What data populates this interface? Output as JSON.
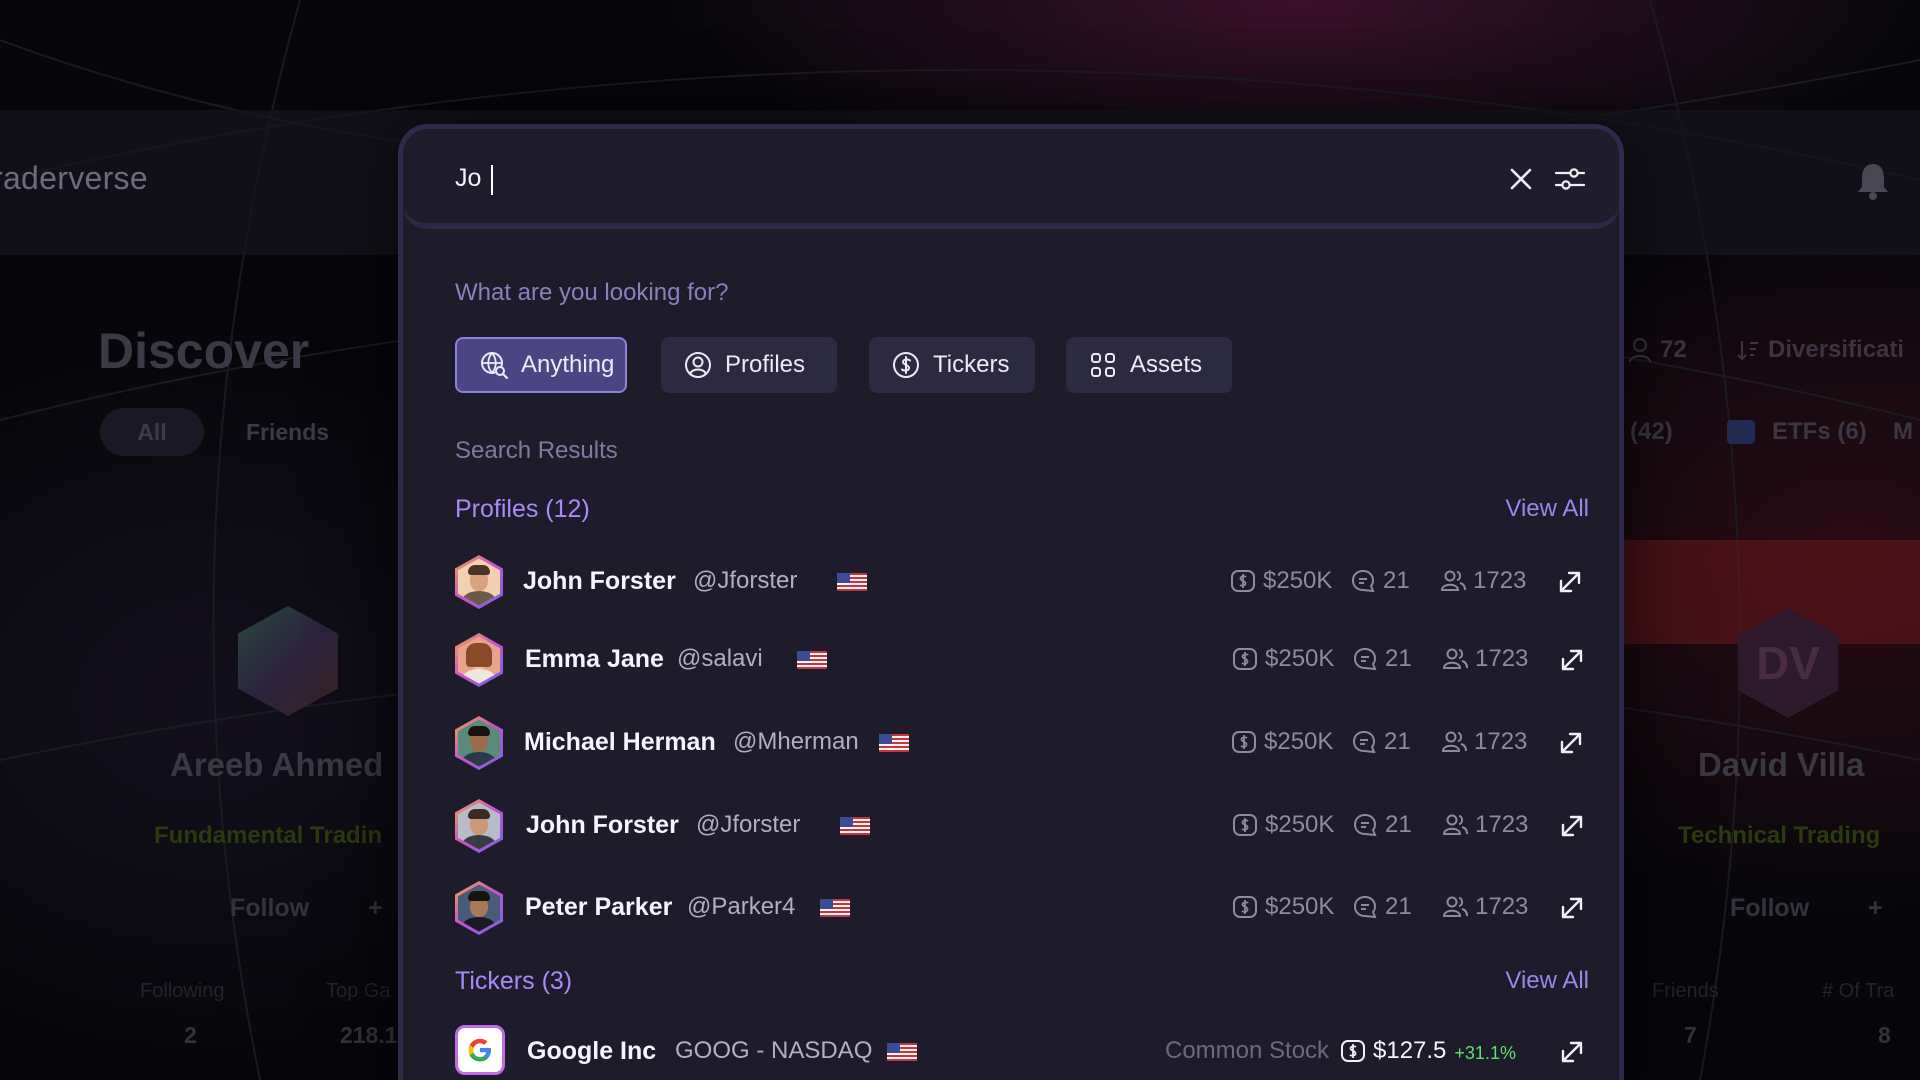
{
  "app": {
    "brand": "raderverse"
  },
  "background": {
    "page_title": "Discover",
    "filters": [
      "All",
      "Friends"
    ],
    "right_stats": {
      "count": "72",
      "label": "Diversificati"
    },
    "right_tabs": [
      "(42)",
      "ETFs (6)",
      "M"
    ],
    "cards": [
      {
        "name": "Areeb Ahmed",
        "role": "Fundamental Tradin",
        "follow": "Follow",
        "stat_labels": [
          "Following",
          "Top Ga"
        ],
        "stat_values": [
          "2",
          "218.1"
        ]
      },
      {
        "name": "David Villa",
        "initials": "DV",
        "role": "Technical Trading",
        "follow": "Follow",
        "stat_labels": [
          "Friends",
          "# Of Tra"
        ],
        "stat_values": [
          "7",
          "8"
        ]
      }
    ]
  },
  "search": {
    "value": "Jo",
    "prompt": "What are you looking for?",
    "categories": [
      {
        "label": "Anything",
        "icon": "globe-search-icon",
        "active": true
      },
      {
        "label": "Profiles",
        "icon": "user-circle-icon",
        "active": false
      },
      {
        "label": "Tickers",
        "icon": "dollar-circle-icon",
        "active": false
      },
      {
        "label": "Assets",
        "icon": "grid-icon",
        "active": false
      }
    ],
    "results_label": "Search Results",
    "profiles": {
      "title": "Profiles (12)",
      "view_all": "View All",
      "items": [
        {
          "name": "John Forster",
          "handle": "@Jforster",
          "value": "$250K",
          "comments": "21",
          "followers": "1723"
        },
        {
          "name": "Emma Jane",
          "handle": "@salavi",
          "value": "$250K",
          "comments": "21",
          "followers": "1723"
        },
        {
          "name": "Michael Herman",
          "handle": "@Mherman",
          "value": "$250K",
          "comments": "21",
          "followers": "1723"
        },
        {
          "name": "John Forster",
          "handle": "@Jforster",
          "value": "$250K",
          "comments": "21",
          "followers": "1723"
        },
        {
          "name": "Peter Parker",
          "handle": "@Parker4",
          "value": "$250K",
          "comments": "21",
          "followers": "1723"
        }
      ]
    },
    "tickers": {
      "title": "Tickers (3)",
      "view_all": "View All",
      "items": [
        {
          "name": "Google Inc",
          "code": "GOOG - NASDAQ",
          "type": "Common Stock",
          "price": "$127.5",
          "change": "+31.1%"
        }
      ]
    }
  },
  "colors": {
    "accent": "#a98bf5",
    "chip_active": "#4b4583",
    "modal_bg": "#1e1b2b",
    "positive": "#5fe06e"
  }
}
